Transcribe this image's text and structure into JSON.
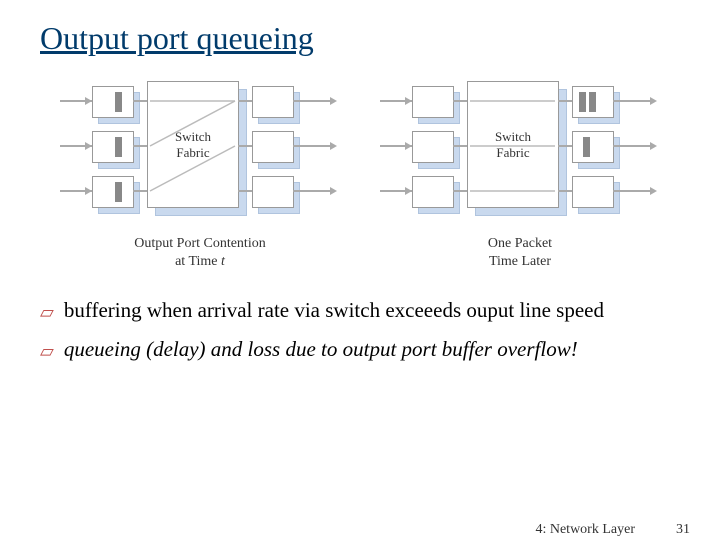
{
  "title": "Output port queueing",
  "diagrams": {
    "left": {
      "fabric_label": "Switch\nFabric",
      "caption_pre": "Output Port Contention\nat Time ",
      "caption_var": "t"
    },
    "right": {
      "fabric_label": "Switch\nFabric",
      "caption": "One Packet\nTime Later"
    }
  },
  "bullets": [
    "buffering when arrival rate via switch exceeeds ouput line speed",
    "queueing (delay) and loss due to output port buffer overflow!"
  ],
  "footer": {
    "chapter": "4: Network Layer",
    "page": "31"
  }
}
